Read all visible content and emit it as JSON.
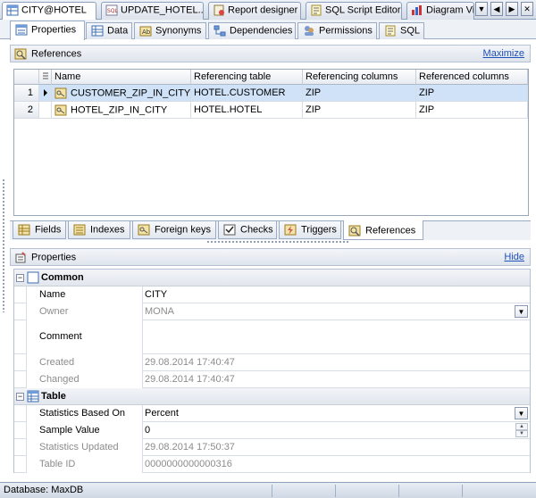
{
  "doc_tabs": [
    {
      "label": "CITY@HOTEL",
      "icon": "table-icon",
      "active": true
    },
    {
      "label": "UPDATE_HOTEL...",
      "icon": "sql-icon",
      "active": false
    },
    {
      "label": "Report designer",
      "icon": "report-icon",
      "active": false
    },
    {
      "label": "SQL Script Editor",
      "icon": "script-icon",
      "active": false
    },
    {
      "label": "Diagram View",
      "icon": "diagram-icon",
      "active": false
    }
  ],
  "nav_buttons": [
    "▼",
    "◀",
    "▶",
    "✕"
  ],
  "object_tabs": [
    {
      "label": "Properties",
      "icon": "properties-icon",
      "active": true
    },
    {
      "label": "Data",
      "icon": "data-icon"
    },
    {
      "label": "Synonyms",
      "icon": "synonyms-icon"
    },
    {
      "label": "Dependencies",
      "icon": "dependencies-icon"
    },
    {
      "label": "Permissions",
      "icon": "permissions-icon"
    },
    {
      "label": "SQL",
      "icon": "sql-icon"
    }
  ],
  "references_panel": {
    "title": "References",
    "link": "Maximize",
    "columns": [
      "Name",
      "Referencing table",
      "Referencing columns",
      "Referenced columns"
    ],
    "rows": [
      {
        "num": "1",
        "name": "CUSTOMER_ZIP_IN_CITY",
        "table": "HOTEL.CUSTOMER",
        "ref_cols": "ZIP",
        "refd_cols": "ZIP"
      },
      {
        "num": "2",
        "name": "HOTEL_ZIP_IN_CITY",
        "table": "HOTEL.HOTEL",
        "ref_cols": "ZIP",
        "refd_cols": "ZIP"
      }
    ]
  },
  "sub_tabs": [
    {
      "label": "Fields",
      "icon": "fields-icon"
    },
    {
      "label": "Indexes",
      "icon": "indexes-icon"
    },
    {
      "label": "Foreign keys",
      "icon": "foreign-key-icon"
    },
    {
      "label": "Checks",
      "icon": "checks-icon"
    },
    {
      "label": "Triggers",
      "icon": "triggers-icon"
    },
    {
      "label": "References",
      "icon": "references-icon",
      "active": true
    }
  ],
  "properties_panel": {
    "title": "Properties",
    "link": "Hide",
    "common": {
      "title": "Common",
      "name_label": "Name",
      "name_value": "CITY",
      "owner_label": "Owner",
      "owner_value": "MONA",
      "comment_label": "Comment",
      "comment_value": "",
      "created_label": "Created",
      "created_value": "29.08.2014 17:40:47",
      "changed_label": "Changed",
      "changed_value": "29.08.2014 17:40:47"
    },
    "table": {
      "title": "Table",
      "stats_label": "Statistics Based On",
      "stats_value": "Percent",
      "sample_label": "Sample Value",
      "sample_value": "0",
      "updated_label": "Statistics Updated",
      "updated_value": "29.08.2014 17:50:37",
      "id_label": "Table ID",
      "id_value": "0000000000000316"
    }
  },
  "status": {
    "database": "Database: MaxDB"
  },
  "colors": {
    "accent": "#1f4fb8",
    "selection": "#cfe2f7",
    "header": "#dfe4ec"
  }
}
